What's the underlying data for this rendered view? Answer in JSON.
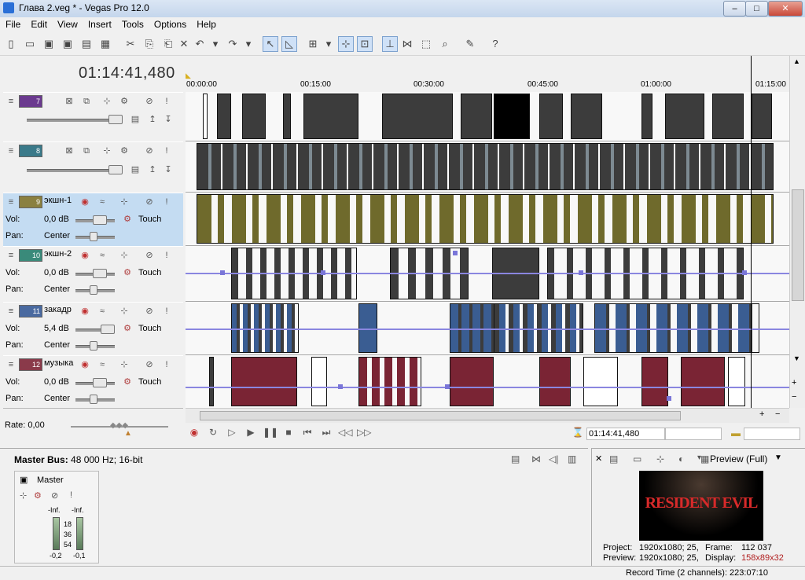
{
  "window": {
    "title": "Глава 2.veg * - Vegas Pro 12.0",
    "minimize": "–",
    "maximize": "□",
    "close": "✕"
  },
  "menu": [
    "File",
    "Edit",
    "View",
    "Insert",
    "Tools",
    "Options",
    "Help"
  ],
  "toolbar_icons": [
    "new-icon",
    "open-icon",
    "save-icon",
    "save-as-icon",
    "render-icon",
    "properties-icon",
    "cut-icon",
    "copy-icon",
    "paste-icon",
    "delete-icon",
    "undo-icon",
    "redo-icon",
    "normal-edit-tool-icon",
    "envelope-tool-icon",
    "select-tool-icon",
    "auto-ripple-icon",
    "lock-envelopes-icon",
    "ignore-grouping-icon",
    "snap-icon",
    "auto-crossfade-icon",
    "zoom-tool-icon",
    "plugin-icon",
    "whats-this-icon"
  ],
  "timecode": "01:14:41,480",
  "ruler_ticks": [
    "00:00:00",
    "00:15:00",
    "00:30:00",
    "00:45:00",
    "01:00:00",
    "01:15:00"
  ],
  "tracks": [
    {
      "number": "7",
      "name": "",
      "kind": "video",
      "color": "#6b3a8f"
    },
    {
      "number": "8",
      "name": "",
      "kind": "video",
      "color": "#3a7a8a"
    },
    {
      "number": "9",
      "name": "экшн-1",
      "kind": "audio",
      "color": "#8a8040",
      "vol": "0,0 dB",
      "pan": "Center",
      "mode": "Touch"
    },
    {
      "number": "10",
      "name": "экшн-2",
      "kind": "audio",
      "color": "#3a8a7a",
      "vol": "0,0 dB",
      "pan": "Center",
      "mode": "Touch"
    },
    {
      "number": "11",
      "name": "закадр",
      "kind": "audio",
      "color": "#4a6aa0",
      "vol": "5,4 dB",
      "pan": "Center",
      "mode": "Touch"
    },
    {
      "number": "12",
      "name": "музыка",
      "kind": "audio",
      "color": "#8a3a4a",
      "vol": "0,0 dB",
      "pan": "Center",
      "mode": "Touch"
    }
  ],
  "labels": {
    "vol": "Vol:",
    "pan": "Pan:"
  },
  "rate": "Rate: 0,00",
  "transport": {
    "cursor_time": "01:14:41,480"
  },
  "master": {
    "title_bold": "Master Bus:",
    "title_rest": " 48 000 Hz; 16-bit",
    "name": "Master",
    "peak_left": "-Inf.",
    "peak_right": "-Inf.",
    "scale": [
      "18",
      "36",
      "54"
    ],
    "level_left": "-0,2",
    "level_right": "-0,1"
  },
  "preview": {
    "mode": "Preview (Full)",
    "thumbnail_text": "RESIDENT EVIL",
    "project_label": "Project:",
    "project_value": "1920x1080; 25,",
    "frame_label": "Frame:",
    "frame_value": "112 037",
    "preview_label": "Preview:",
    "preview_value": "1920x1080; 25,",
    "display_label": "Display:",
    "display_value": "158x89x32"
  },
  "status": "Record Time (2 channels): 223:07:10",
  "colors": {
    "video_clip": "#3c3c3c",
    "audio_olive": "#6f6a2c",
    "audio_blue": "#3a5d92",
    "music_red": "#7a2434",
    "envelope": "#8a86e0",
    "selected_header": "#c4dcf2"
  }
}
